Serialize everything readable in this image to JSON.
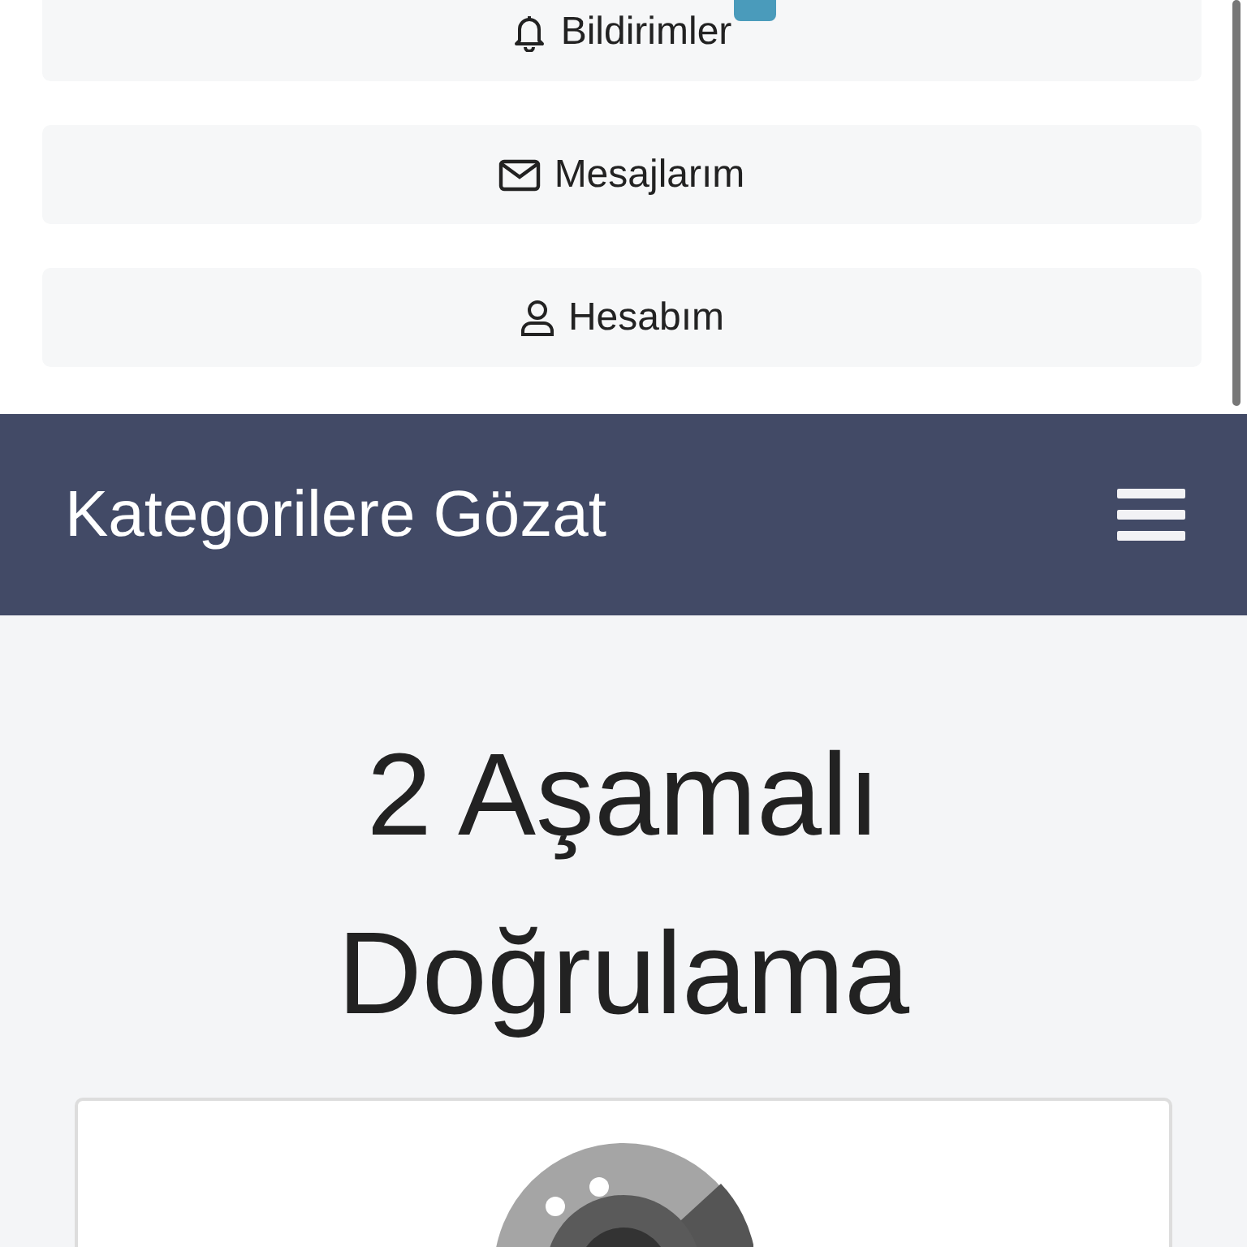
{
  "menu": {
    "items": [
      {
        "kind": "notifications",
        "label": "Bildirimler",
        "badge": true
      },
      {
        "kind": "messages",
        "label": "Mesajlarım",
        "badge": false
      },
      {
        "kind": "account",
        "label": "Hesabım",
        "badge": false
      }
    ]
  },
  "navbar": {
    "title": "Kategorilere Gözat"
  },
  "page": {
    "heading": "2 Aşamalı Doğrulama"
  }
}
